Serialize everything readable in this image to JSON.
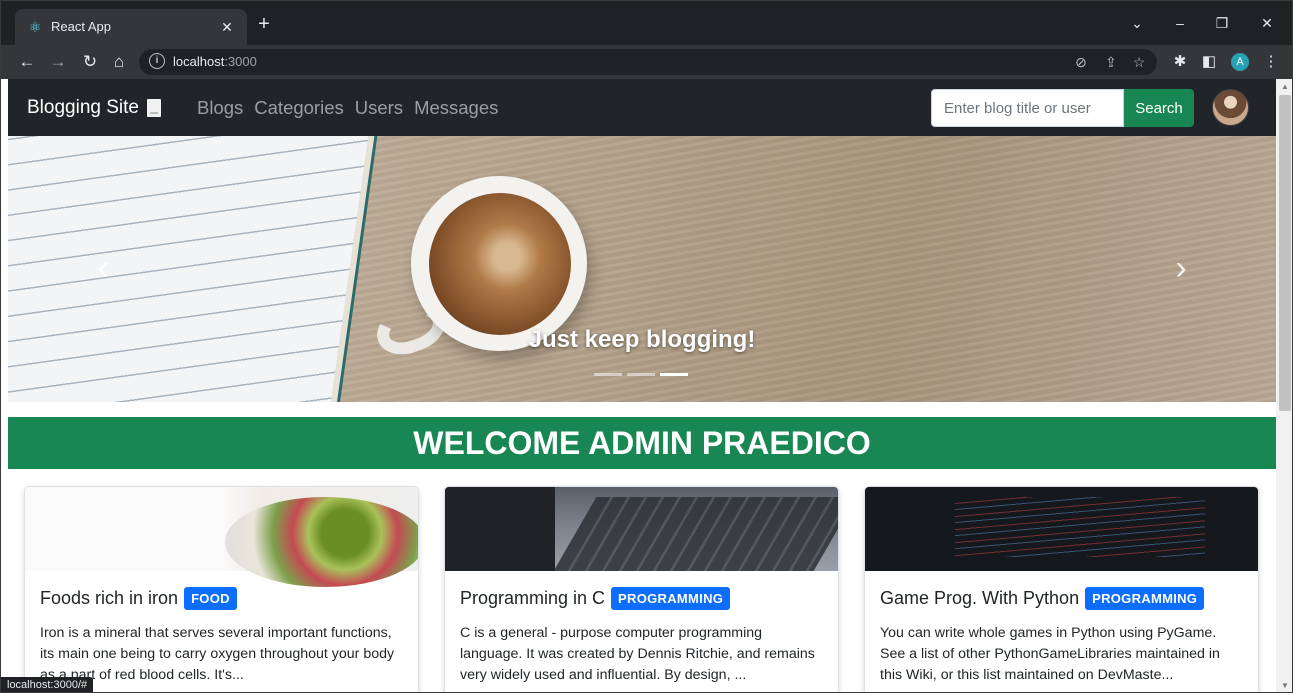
{
  "browser": {
    "tab_title": "React App",
    "url_host": "localhost",
    "url_port": ":3000",
    "profile_initial": "A",
    "status_url": "localhost:3000/#"
  },
  "navbar": {
    "brand": "Blogging Site",
    "links": [
      "Blogs",
      "Categories",
      "Users",
      "Messages"
    ],
    "search_placeholder": "Enter blog title or user",
    "search_button": "Search"
  },
  "carousel": {
    "caption": "Just keep blogging!",
    "slide_count": 3,
    "active_index": 2
  },
  "welcome": "WELCOME ADMIN PRAEDICO",
  "cards": [
    {
      "title": "Foods rich in iron",
      "category": "FOOD",
      "excerpt": "Iron is a mineral that serves several important functions, its main one being to carry oxygen throughout your body as a part of red blood cells. It's..."
    },
    {
      "title": "Programming in C",
      "category": "PROGRAMMING",
      "excerpt": "C is a general - purpose computer programming language. It was created by Dennis Ritchie, and remains very widely used and influential. By design, ..."
    },
    {
      "title": "Game Prog. With Python",
      "category": "PROGRAMMING",
      "excerpt": "You can write whole games in Python using PyGame. See a list of other PythonGameLibraries maintained in this Wiki, or this list maintained on DevMaste..."
    }
  ],
  "colors": {
    "navbar_bg": "#212529",
    "accent_green": "#198754",
    "badge_blue": "#0d6efd"
  }
}
